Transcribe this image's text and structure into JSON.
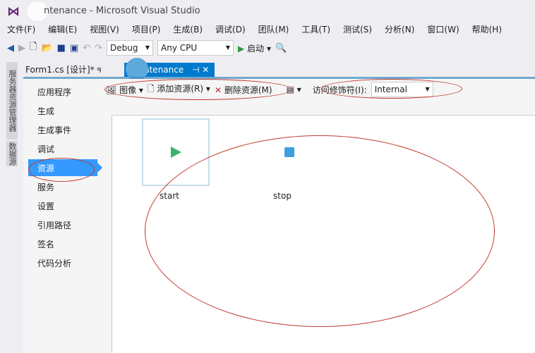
{
  "window": {
    "title": "ntenance - Microsoft Visual Studio"
  },
  "menu": [
    "文件(F)",
    "编辑(E)",
    "视图(V)",
    "项目(P)",
    "生成(B)",
    "调试(D)",
    "团队(M)",
    "工具(T)",
    "测试(S)",
    "分析(N)",
    "窗口(W)",
    "帮助(H)"
  ],
  "toolbar": {
    "config": "Debug",
    "platform": "Any CPU",
    "start": "启动"
  },
  "side_tabs": [
    "服务器资源管理器",
    "数据源"
  ],
  "tabs": [
    {
      "label": "Form1.cs [设计]*"
    },
    {
      "label": "ntenance"
    }
  ],
  "nav": [
    "应用程序",
    "生成",
    "生成事件",
    "调试",
    "资源",
    "服务",
    "设置",
    "引用路径",
    "签名",
    "代码分析"
  ],
  "nav_selected": "资源",
  "res_toolbar": {
    "type": "图像",
    "add": "添加资源(R)",
    "remove": "删除资源(M)",
    "access_label": "访问修饰符(I):",
    "access_value": "Internal"
  },
  "resources": [
    {
      "name": "start",
      "icon": "play-icon",
      "color": "#3cb371"
    },
    {
      "name": "stop",
      "icon": "stop-icon",
      "color": "#3aa0e0"
    }
  ]
}
